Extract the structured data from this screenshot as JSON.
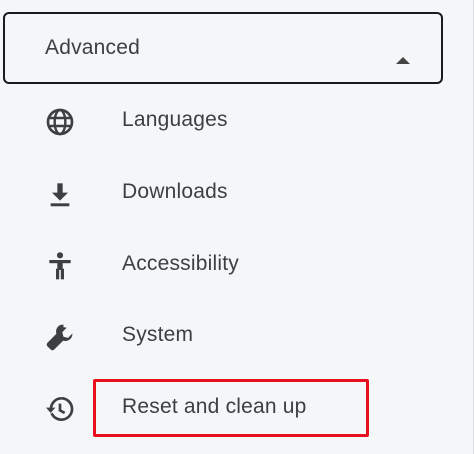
{
  "advanced": {
    "label": "Advanced",
    "expanded": true,
    "arrow_icon": "triangle-up-icon"
  },
  "items": [
    {
      "label": "Languages",
      "icon": "globe-icon"
    },
    {
      "label": "Downloads",
      "icon": "download-icon"
    },
    {
      "label": "Accessibility",
      "icon": "accessibility-icon"
    },
    {
      "label": "System",
      "icon": "wrench-icon"
    },
    {
      "label": "Reset and clean up",
      "icon": "history-icon"
    }
  ],
  "colors": {
    "text": "#3c4043",
    "icon": "#3c4043",
    "highlight": "#e8101c",
    "panel_background": "#f4f6f8"
  }
}
